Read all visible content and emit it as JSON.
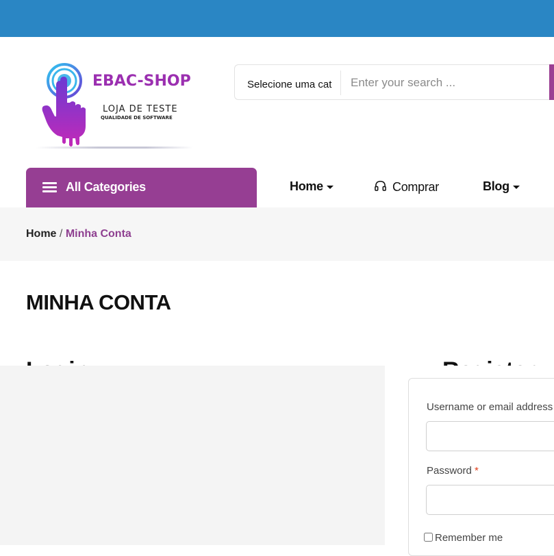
{
  "colors": {
    "topbar": "#2a86c4",
    "brand_purple": "#963e93",
    "breadcrumb_active": "#8e3f90",
    "required_star": "#e2401c"
  },
  "logo": {
    "title": "EBAC-SHOP",
    "subtitle": "LOJA DE TESTE",
    "tagline": "QUALIDADE DE SOFTWARE",
    "icon": "hand-touch-icon"
  },
  "search": {
    "category_label": "Selecione uma cat",
    "placeholder": "Enter your search ..."
  },
  "nav": {
    "all_categories": "All Categories",
    "items": [
      {
        "label": "Home",
        "icon": "caret-down-icon"
      },
      {
        "label": "Comprar",
        "icon": "headset-icon"
      },
      {
        "label": "Blog",
        "icon": "caret-down-icon"
      }
    ]
  },
  "breadcrumb": {
    "home": "Home",
    "separator": "/",
    "current": "Minha Conta"
  },
  "page": {
    "title": "MINHA CONTA",
    "login_heading": "Login",
    "register_heading": "Register"
  },
  "login_form": {
    "username_label": "Username or email address",
    "password_label": "Password",
    "required_mark": "*",
    "remember_label": "Remember me"
  }
}
